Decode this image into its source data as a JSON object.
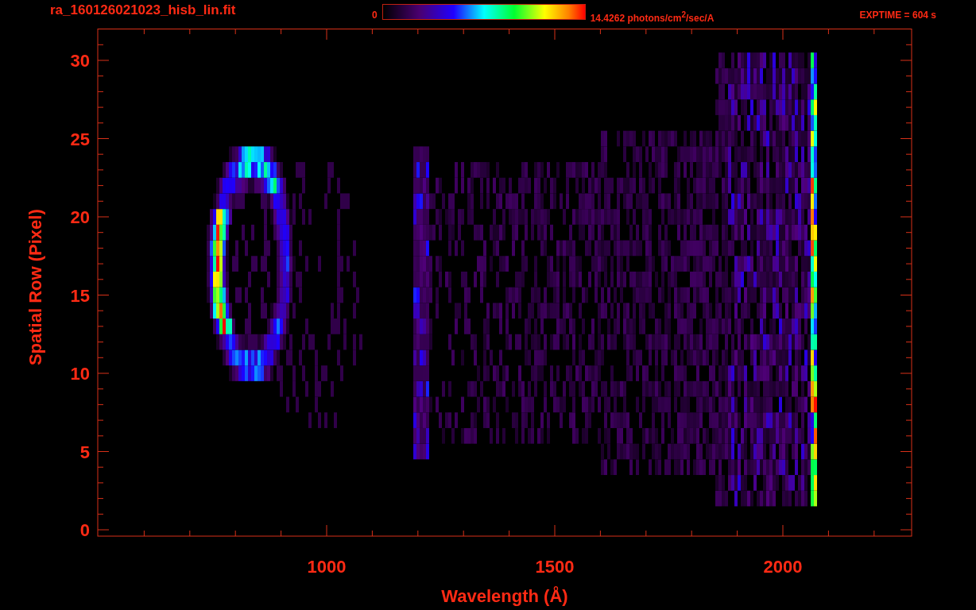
{
  "header": {
    "filename": "ra_160126021023_hisb_lin.fit",
    "colorbar": {
      "min_label": "0",
      "max_label": "14.4262 photons/cm$^{2}$/sec/A"
    },
    "exptime": "EXPTIME = 604 s"
  },
  "plot": {
    "ylabel": "Spatial Row (Pixel)",
    "xlabel": "Wavelength (Å)",
    "yticks": [
      "30",
      "25",
      "20",
      "15",
      "10",
      "5",
      "0"
    ],
    "xticks": [
      "1000",
      "1500",
      "2000"
    ]
  }
}
